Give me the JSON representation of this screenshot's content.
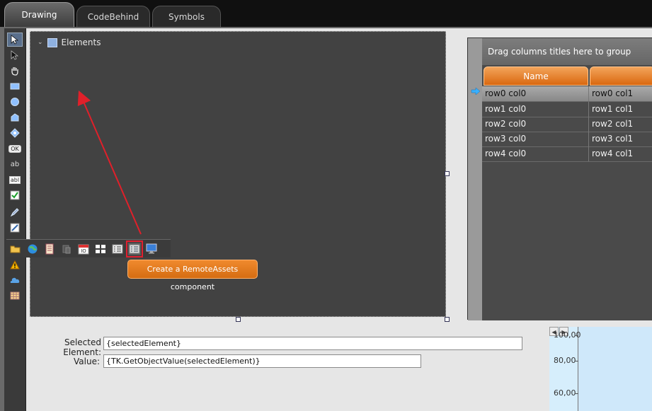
{
  "tabs": [
    {
      "label": "Drawing",
      "active": true
    },
    {
      "label": "CodeBehind",
      "active": false
    },
    {
      "label": "Symbols",
      "active": false
    }
  ],
  "left_toolbar": {
    "tools": [
      "selection-arrow-icon",
      "direct-select-arrow-icon",
      "pan-hand-icon",
      "rectangle-icon",
      "ellipse-icon",
      "polygon-icon",
      "path-node-icon",
      "button-ok-icon",
      "text-icon",
      "textbox-icon",
      "checkbox-icon",
      "pen-icon",
      "image-editor-icon",
      "warning-icon",
      "cloud-icon",
      "table-icon"
    ],
    "ok_label": "OK",
    "ab_label": "ab",
    "abl_label": "abl"
  },
  "canvas": {
    "tree_label": "Elements"
  },
  "component_toolbar": {
    "icons": [
      "open-folder-icon",
      "globe-icon",
      "book-icon",
      "database-icon",
      "calendar-icon",
      "grid-icon",
      "list-icon",
      "remote-assets-icon",
      "monitor-icon"
    ],
    "highlighted": "remote-assets-icon"
  },
  "tooltip": {
    "text": "Create a RemoteAssets component"
  },
  "datagrid": {
    "group_hint": "Drag columns titles here to group data.",
    "columns": [
      "Name",
      ""
    ],
    "rows": [
      [
        "row0 col0",
        "row0 col1"
      ],
      [
        "row1 col0",
        "row1 col1"
      ],
      [
        "row2 col0",
        "row2 col1"
      ],
      [
        "row3 col0",
        "row3 col1"
      ],
      [
        "row4 col0",
        "row4 col1"
      ]
    ]
  },
  "form": {
    "selected_label": "Selected Element:",
    "selected_value": "{selectedElement}",
    "value_label": "Value:",
    "value_value": "{TK.GetObjectValue(selectedElement)}"
  },
  "chart": {
    "ticks": [
      "100,00",
      "80,00",
      "60,00"
    ]
  },
  "colors": {
    "accent_orange": "#e27a1f",
    "highlight_red": "#e02030",
    "canvas_bg": "#424242"
  }
}
